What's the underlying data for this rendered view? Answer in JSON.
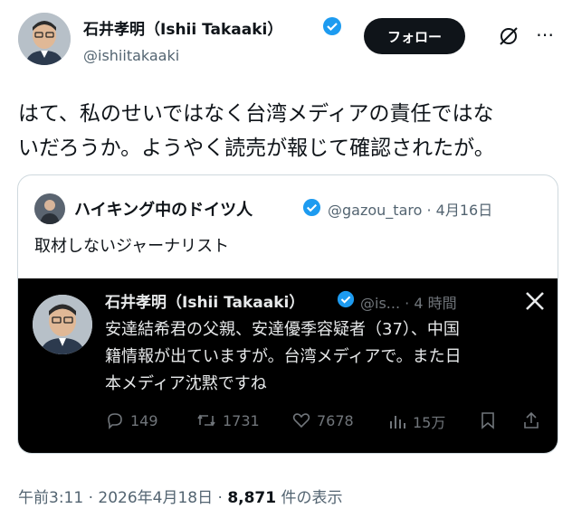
{
  "author": {
    "name": "石井孝明（Ishii Takaaki）",
    "handle": "@ishiitakaaki",
    "follow_label": "フォロー"
  },
  "tweet": {
    "text_line1": "はて、私のせいではなく台湾メディアの責任ではな",
    "text_line2": "いだろうか。ようやく読売が報じて確認されたが。"
  },
  "quote": {
    "author_name": "ハイキング中のドイツ人",
    "handle": "@gazou_taro",
    "separator": "·",
    "date": "4月16日",
    "text": "取材しないジャーナリスト"
  },
  "embedded": {
    "author_name": "石井孝明（Ishii Takaaki）",
    "handle": "@is...",
    "separator": "·",
    "time": "4 時間",
    "text_line1": "安達結希君の父親、安達優季容疑者（37）、中国",
    "text_line2": "籍情報が出ていますが。台湾メディアで。また日",
    "text_line3": "本メディア沈黙ですね",
    "replies": "149",
    "retweets": "1731",
    "likes": "7678",
    "views": "15万"
  },
  "footer": {
    "time": "午前3:11 · 2026年4月18日 · ",
    "views": "8,871",
    "views_label": " 件の表示"
  },
  "colors": {
    "verified": "#1d9bf0",
    "text": "#0f1419",
    "muted": "#536471"
  }
}
